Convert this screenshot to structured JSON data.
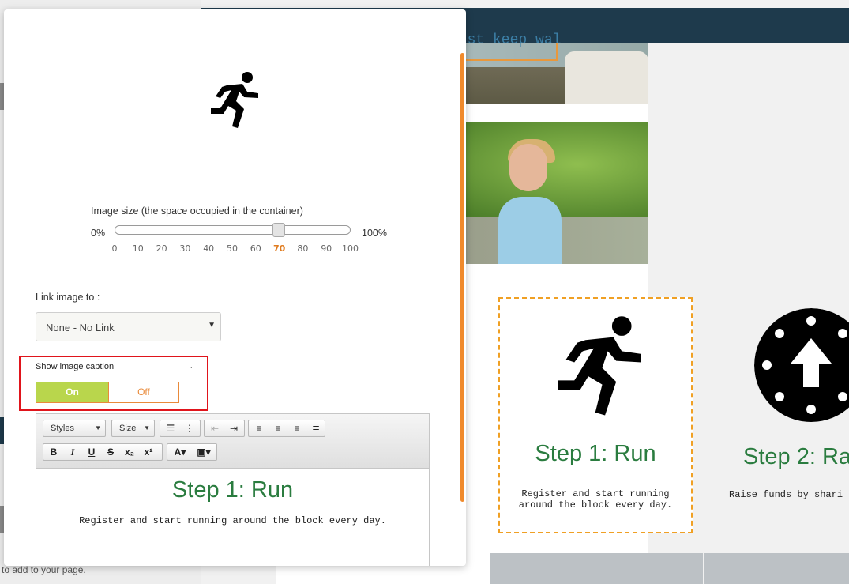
{
  "background": {
    "hint_text": "to add to your page.",
    "hero_text": "Just keep wal"
  },
  "cards": [
    {
      "title": "Step 1: Run",
      "text": "Register and start running around the block every day."
    },
    {
      "title": "Step 2: Ra",
      "text": "Raise funds by shari fundraising pag"
    }
  ],
  "modal": {
    "image_size": {
      "label": "Image size (the space occupied in the container)",
      "min_label": "0%",
      "max_label": "100%",
      "value": 70,
      "ticks": [
        "0",
        "10",
        "20",
        "30",
        "40",
        "50",
        "60",
        "70",
        "80",
        "90",
        "100"
      ]
    },
    "link": {
      "label": "Link image to :",
      "selected": "None - No Link"
    },
    "caption": {
      "label": "Show image caption",
      "dot": ".",
      "on_label": "On",
      "off_label": "Off",
      "state": "on"
    },
    "editor": {
      "styles_label": "Styles",
      "size_label": "Size",
      "title": "Step 1: Run",
      "text": "Register and start running around the block every day."
    }
  },
  "colors": {
    "accent_orange": "#f08a2c",
    "toggle_green": "#b9d64c",
    "title_green": "#2a7c3f",
    "highlight_red": "#e0141b",
    "header_navy": "#1e3a4c"
  }
}
